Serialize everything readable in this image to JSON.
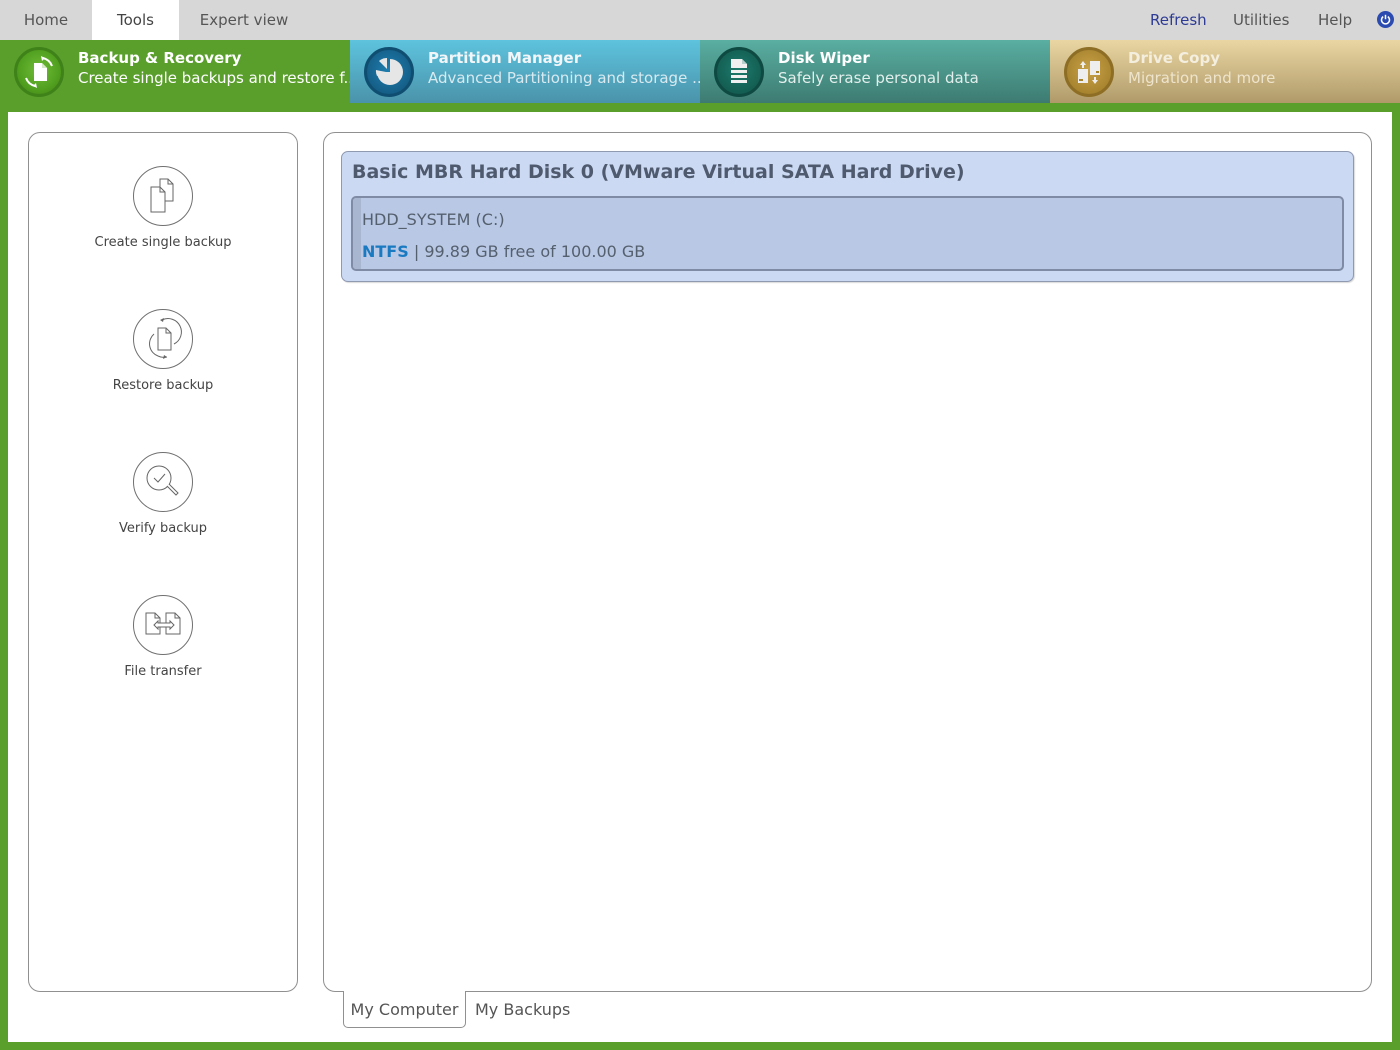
{
  "menubar": {
    "tabs": [
      {
        "label": "Home",
        "active": false
      },
      {
        "label": "Tools",
        "active": true
      },
      {
        "label": "Expert view",
        "active": false
      }
    ],
    "right_items": [
      {
        "label": "Refresh"
      },
      {
        "label": "Utilities"
      },
      {
        "label": "Help"
      }
    ],
    "power_icon": "power-icon"
  },
  "modules": [
    {
      "title": "Backup & Recovery",
      "subtitle": "Create single backups and restore f...",
      "icon": "backup-recovery-icon",
      "active": true,
      "color": "#5a9f2c"
    },
    {
      "title": "Partition Manager",
      "subtitle": "Advanced Partitioning and storage ...",
      "icon": "pie-chart-icon",
      "active": false,
      "color": "#4fa9c4"
    },
    {
      "title": "Disk Wiper",
      "subtitle": "Safely erase personal data",
      "icon": "document-wipe-icon",
      "active": false,
      "color": "#4c958a"
    },
    {
      "title": "Drive Copy",
      "subtitle": "Migration and more",
      "icon": "drive-copy-icon",
      "active": false,
      "color": "#d9c38d"
    }
  ],
  "actions": [
    {
      "label": "Create single backup",
      "icon": "copy-documents-icon"
    },
    {
      "label": "Restore backup",
      "icon": "restore-document-icon"
    },
    {
      "label": "Verify backup",
      "icon": "verify-magnifier-icon"
    },
    {
      "label": "File transfer",
      "icon": "file-transfer-icon"
    }
  ],
  "disk": {
    "title": "Basic MBR Hard Disk 0 (VMware Virtual SATA Hard Drive)",
    "partitions": [
      {
        "name": "HDD_SYSTEM (C:)",
        "filesystem": "NTFS",
        "separator": "|",
        "usage": "99.89 GB free of 100.00 GB"
      }
    ]
  },
  "bottom_tabs": [
    {
      "label": "My Computer",
      "active": true
    },
    {
      "label": "My Backups",
      "active": false
    }
  ]
}
